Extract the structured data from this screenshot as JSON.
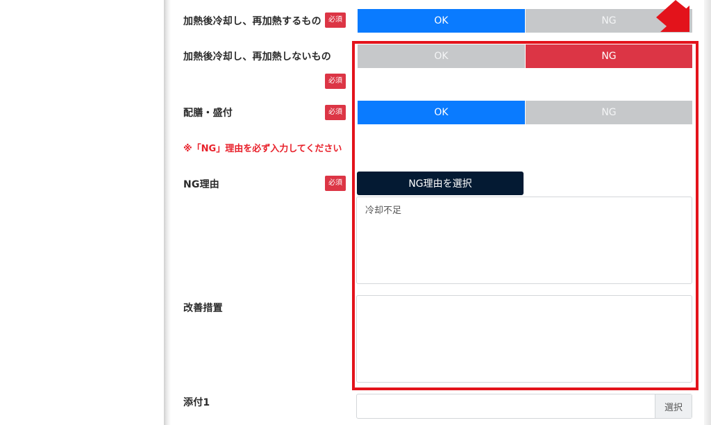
{
  "form": {
    "rows": [
      {
        "label": "加熱後冷却し、再加熱するもの",
        "required": "必須",
        "ok": "OK",
        "ng": "NG"
      },
      {
        "label": "加熱後冷却し、再加熱しないもの",
        "required": "必須",
        "ok": "OK",
        "ng": "NG"
      },
      {
        "label": "配膳・盛付",
        "required": "必須",
        "ok": "OK",
        "ng": "NG"
      }
    ],
    "warning": "※「NG」理由を必ず入力してください",
    "ng_reason": {
      "label": "NG理由",
      "required": "必須",
      "button": "NG理由を選択",
      "text": "冷却不足"
    },
    "improvement": {
      "label": "改善措置",
      "text": ""
    },
    "attachment": {
      "label": "添付1",
      "button": "選択"
    }
  },
  "annotation": {
    "highlight_color": "#e3131b"
  },
  "colors": {
    "ok_active": "#0a7bff",
    "ng_active": "#dc3545",
    "inactive": "#c6c8ca",
    "select_button": "#041a33",
    "required_badge": "#dc3545"
  }
}
